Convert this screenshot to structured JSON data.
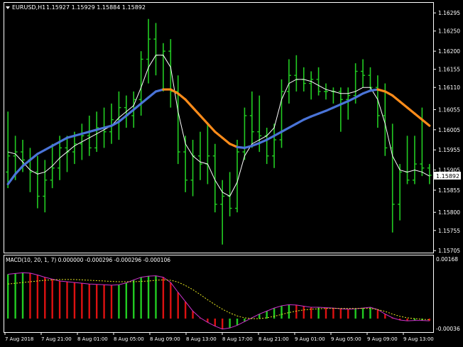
{
  "colors": {
    "background": "#000000",
    "frame": "#ffffff",
    "candle": "#22cc22",
    "close_line": "#ffffff",
    "ma_up": "#4a74d8",
    "ma_down": "#ff8c1a",
    "macd_up": "#22cc22",
    "macd_down": "#dd1111",
    "macd_line": "#cc33cc",
    "signal_line": "#e8e820",
    "price_label_bg": "#ffffff",
    "price_label_fg": "#000000"
  },
  "chart": {
    "icon": "triangle-down-icon",
    "symbol": "EURUSD,H1",
    "ohlc": "1.15927 1.15929 1.15884 1.15892",
    "current_price_label": "1.15892"
  },
  "macd": {
    "header": "MACD(10, 20, 1, 7) 0.000000 -0.000296 -0.000296 -0.000106",
    "axis_top_label": "0.00168",
    "axis_bottom_label": "-0.00036"
  },
  "chart_data": [
    {
      "type": "candlestick",
      "title": "EURUSD,H1",
      "ylim": [
        1.157,
        1.1632
      ],
      "y_ticks": [
        "1.16295",
        "1.16250",
        "1.16200",
        "1.16155",
        "1.16110",
        "1.16055",
        "1.16005",
        "1.15955",
        "1.15905",
        "1.15855",
        "1.15800",
        "1.15755",
        "1.15705"
      ],
      "y_tick_values": [
        1.16295,
        1.1625,
        1.162,
        1.16155,
        1.1611,
        1.16055,
        1.16005,
        1.15955,
        1.15905,
        1.15855,
        1.158,
        1.15755,
        1.15705
      ],
      "x_ticks": [
        "7 Aug 2018",
        "7 Aug 21:00",
        "8 Aug 01:00",
        "8 Aug 05:00",
        "8 Aug 09:00",
        "8 Aug 13:00",
        "8 Aug 17:00",
        "8 Aug 21:00",
        "9 Aug 01:00",
        "9 Aug 05:00",
        "9 Aug 09:00",
        "9 Aug 13:00"
      ],
      "bars": [
        {
          "o": 1.159,
          "h": 1.1605,
          "l": 1.1586,
          "c": 1.1594
        },
        {
          "o": 1.1594,
          "h": 1.1599,
          "l": 1.1588,
          "c": 1.1595
        },
        {
          "o": 1.1595,
          "h": 1.1598,
          "l": 1.159,
          "c": 1.1593
        },
        {
          "o": 1.1593,
          "h": 1.1596,
          "l": 1.1585,
          "c": 1.159
        },
        {
          "o": 1.159,
          "h": 1.1594,
          "l": 1.1581,
          "c": 1.1584
        },
        {
          "o": 1.1584,
          "h": 1.1593,
          "l": 1.158,
          "c": 1.1588
        },
        {
          "o": 1.1588,
          "h": 1.1597,
          "l": 1.1586,
          "c": 1.1591
        },
        {
          "o": 1.1591,
          "h": 1.1599,
          "l": 1.1588,
          "c": 1.1596
        },
        {
          "o": 1.1596,
          "h": 1.1599,
          "l": 1.159,
          "c": 1.1595
        },
        {
          "o": 1.1595,
          "h": 1.16,
          "l": 1.1592,
          "c": 1.1597
        },
        {
          "o": 1.1597,
          "h": 1.1602,
          "l": 1.1593,
          "c": 1.1599
        },
        {
          "o": 1.1599,
          "h": 1.1604,
          "l": 1.1594,
          "c": 1.1596
        },
        {
          "o": 1.1596,
          "h": 1.1605,
          "l": 1.1595,
          "c": 1.1601
        },
        {
          "o": 1.1601,
          "h": 1.1606,
          "l": 1.1596,
          "c": 1.16
        },
        {
          "o": 1.16,
          "h": 1.1607,
          "l": 1.1597,
          "c": 1.1603
        },
        {
          "o": 1.1603,
          "h": 1.161,
          "l": 1.1598,
          "c": 1.1606
        },
        {
          "o": 1.1606,
          "h": 1.1609,
          "l": 1.1601,
          "c": 1.1604
        },
        {
          "o": 1.1604,
          "h": 1.161,
          "l": 1.1601,
          "c": 1.1608
        },
        {
          "o": 1.1608,
          "h": 1.162,
          "l": 1.1604,
          "c": 1.1618
        },
        {
          "o": 1.1618,
          "h": 1.1628,
          "l": 1.1612,
          "c": 1.1623
        },
        {
          "o": 1.1623,
          "h": 1.1627,
          "l": 1.1614,
          "c": 1.1619
        },
        {
          "o": 1.1619,
          "h": 1.1622,
          "l": 1.161,
          "c": 1.162
        },
        {
          "o": 1.162,
          "h": 1.1623,
          "l": 1.1606,
          "c": 1.161
        },
        {
          "o": 1.161,
          "h": 1.1614,
          "l": 1.1592,
          "c": 1.1595
        },
        {
          "o": 1.1595,
          "h": 1.1599,
          "l": 1.1585,
          "c": 1.1588
        },
        {
          "o": 1.1588,
          "h": 1.1598,
          "l": 1.1584,
          "c": 1.1594
        },
        {
          "o": 1.1594,
          "h": 1.16,
          "l": 1.1588,
          "c": 1.1592
        },
        {
          "o": 1.1592,
          "h": 1.1602,
          "l": 1.1587,
          "c": 1.1594
        },
        {
          "o": 1.1594,
          "h": 1.1597,
          "l": 1.158,
          "c": 1.1582
        },
        {
          "o": 1.1582,
          "h": 1.1588,
          "l": 1.1572,
          "c": 1.1584
        },
        {
          "o": 1.1584,
          "h": 1.159,
          "l": 1.1579,
          "c": 1.1581
        },
        {
          "o": 1.1581,
          "h": 1.1598,
          "l": 1.158,
          "c": 1.1595
        },
        {
          "o": 1.1595,
          "h": 1.1606,
          "l": 1.1593,
          "c": 1.1604
        },
        {
          "o": 1.1604,
          "h": 1.161,
          "l": 1.1596,
          "c": 1.16
        },
        {
          "o": 1.16,
          "h": 1.1609,
          "l": 1.1595,
          "c": 1.1599
        },
        {
          "o": 1.1599,
          "h": 1.1601,
          "l": 1.1592,
          "c": 1.1594
        },
        {
          "o": 1.1594,
          "h": 1.1602,
          "l": 1.1591,
          "c": 1.1598
        },
        {
          "o": 1.1598,
          "h": 1.1613,
          "l": 1.1596,
          "c": 1.161
        },
        {
          "o": 1.161,
          "h": 1.1618,
          "l": 1.1607,
          "c": 1.1614
        },
        {
          "o": 1.1614,
          "h": 1.1619,
          "l": 1.161,
          "c": 1.1613
        },
        {
          "o": 1.1613,
          "h": 1.1616,
          "l": 1.161,
          "c": 1.1612
        },
        {
          "o": 1.1612,
          "h": 1.1615,
          "l": 1.1608,
          "c": 1.1613
        },
        {
          "o": 1.1613,
          "h": 1.1616,
          "l": 1.1609,
          "c": 1.161
        },
        {
          "o": 1.161,
          "h": 1.1612,
          "l": 1.1608,
          "c": 1.161
        },
        {
          "o": 1.161,
          "h": 1.1611,
          "l": 1.1607,
          "c": 1.161
        },
        {
          "o": 1.161,
          "h": 1.1611,
          "l": 1.16,
          "c": 1.1608
        },
        {
          "o": 1.1608,
          "h": 1.1611,
          "l": 1.1603,
          "c": 1.1609
        },
        {
          "o": 1.1609,
          "h": 1.1617,
          "l": 1.1607,
          "c": 1.1615
        },
        {
          "o": 1.1615,
          "h": 1.1618,
          "l": 1.1611,
          "c": 1.1614
        },
        {
          "o": 1.1614,
          "h": 1.1616,
          "l": 1.161,
          "c": 1.1611
        },
        {
          "o": 1.1611,
          "h": 1.1614,
          "l": 1.1601,
          "c": 1.1604
        },
        {
          "o": 1.1604,
          "h": 1.1612,
          "l": 1.1594,
          "c": 1.1596
        },
        {
          "o": 1.1596,
          "h": 1.1602,
          "l": 1.1575,
          "c": 1.1582
        },
        {
          "o": 1.1582,
          "h": 1.1592,
          "l": 1.1578,
          "c": 1.159
        },
        {
          "o": 1.159,
          "h": 1.1599,
          "l": 1.1587,
          "c": 1.1588
        },
        {
          "o": 1.1588,
          "h": 1.1599,
          "l": 1.1587,
          "c": 1.1592
        },
        {
          "o": 1.1592,
          "h": 1.1606,
          "l": 1.1589,
          "c": 1.1591
        },
        {
          "o": 1.1591,
          "h": 1.1592,
          "l": 1.1587,
          "c": 1.15892
        }
      ],
      "close_line": [
        1.1595,
        1.15945,
        1.15925,
        1.15905,
        1.15895,
        1.159,
        1.15915,
        1.15935,
        1.1595,
        1.15965,
        1.15975,
        1.15985,
        1.15995,
        1.16005,
        1.16015,
        1.16035,
        1.1605,
        1.16065,
        1.1611,
        1.1616,
        1.1619,
        1.1619,
        1.1616,
        1.1605,
        1.1597,
        1.1594,
        1.15925,
        1.1592,
        1.1588,
        1.1585,
        1.1584,
        1.15875,
        1.1594,
        1.1597,
        1.1598,
        1.1599,
        1.1601,
        1.1608,
        1.1612,
        1.1613,
        1.1613,
        1.16125,
        1.16115,
        1.16105,
        1.161,
        1.16095,
        1.16095,
        1.161,
        1.1611,
        1.1611,
        1.1608,
        1.1602,
        1.1594,
        1.15905,
        1.159,
        1.15905,
        1.159,
        1.1589
      ],
      "ma_line": [
        1.1587,
        1.15895,
        1.15915,
        1.1593,
        1.15945,
        1.15955,
        1.15965,
        1.15975,
        1.15985,
        1.1599,
        1.15995,
        1.16,
        1.16005,
        1.1601,
        1.16015,
        1.16025,
        1.1604,
        1.16055,
        1.1607,
        1.16085,
        1.161,
        1.16105,
        1.16105,
        1.16095,
        1.1608,
        1.1606,
        1.1604,
        1.1602,
        1.16,
        1.15985,
        1.1597,
        1.15962,
        1.1596,
        1.15965,
        1.15972,
        1.1598,
        1.1599,
        1.16,
        1.1601,
        1.1602,
        1.1603,
        1.16038,
        1.16045,
        1.16052,
        1.1606,
        1.16068,
        1.16076,
        1.16085,
        1.16095,
        1.16102,
        1.16105,
        1.161,
        1.1609,
        1.16075,
        1.1606,
        1.16045,
        1.1603,
        1.16015
      ],
      "ma_direction": [
        "up",
        "up",
        "up",
        "up",
        "up",
        "up",
        "up",
        "up",
        "up",
        "up",
        "up",
        "up",
        "up",
        "up",
        "up",
        "up",
        "up",
        "up",
        "up",
        "up",
        "up",
        "up",
        "down",
        "down",
        "down",
        "down",
        "down",
        "down",
        "down",
        "down",
        "down",
        "down",
        "up",
        "up",
        "up",
        "up",
        "up",
        "up",
        "up",
        "up",
        "up",
        "up",
        "up",
        "up",
        "up",
        "up",
        "up",
        "up",
        "up",
        "up",
        "up",
        "down",
        "down",
        "down",
        "down",
        "down",
        "down",
        "down"
      ]
    },
    {
      "type": "bar",
      "title": "MACD(10, 20, 1, 7)",
      "ylim": [
        -0.00036,
        0.00168
      ],
      "y_ticks": [
        "0.00168",
        "-0.00036"
      ],
      "histogram": [
        0.00118,
        0.0012,
        0.00122,
        0.00121,
        0.00116,
        0.0011,
        0.00105,
        0.001,
        0.00098,
        0.00096,
        0.00094,
        0.00092,
        0.00091,
        0.0009,
        0.00089,
        0.0009,
        0.00095,
        0.00103,
        0.0011,
        0.00113,
        0.00114,
        0.0011,
        0.00096,
        0.0007,
        0.00045,
        0.0002,
        2e-05,
        -0.0001,
        -0.0002,
        -0.00028,
        -0.00025,
        -0.00018,
        -8e-05,
        2e-05,
        0.00012,
        0.0002,
        0.00028,
        0.00034,
        0.00037,
        0.00036,
        0.00033,
        0.0003,
        0.0003,
        0.00029,
        0.00028,
        0.00026,
        0.00025,
        0.00026,
        0.00028,
        0.0003,
        0.00024,
        0.00012,
        2e-05,
        -4e-05,
        -6e-05,
        -5e-05,
        -5e-05,
        -6e-05
      ],
      "signal": [
        0.00092,
        0.00094,
        0.00096,
        0.00098,
        0.001,
        0.00102,
        0.00103,
        0.00104,
        0.00104,
        0.00104,
        0.00103,
        0.00102,
        0.00101,
        0.001,
        0.00099,
        0.00098,
        0.00098,
        0.00098,
        0.00099,
        0.001,
        0.00102,
        0.00103,
        0.00102,
        0.00097,
        0.00088,
        0.00077,
        0.00064,
        0.0005,
        0.00037,
        0.00025,
        0.00015,
        7e-05,
        2e-05,
        0.0,
        0.0,
        2e-05,
        6e-05,
        0.00011,
        0.00016,
        0.0002,
        0.00023,
        0.00025,
        0.00026,
        0.00027,
        0.00027,
        0.00027,
        0.00027,
        0.00027,
        0.00027,
        0.00027,
        0.00024,
        0.00019,
        0.00012,
        6e-05,
        2e-05,
        0.0,
        -2e-05,
        -3e-05
      ]
    }
  ]
}
